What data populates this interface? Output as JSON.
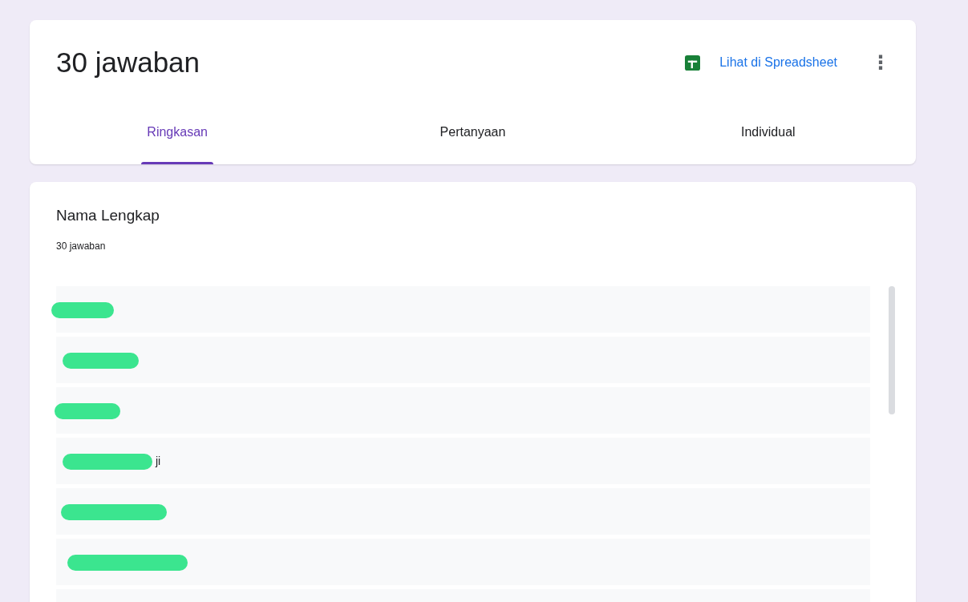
{
  "header": {
    "title": "30 jawaban",
    "sheet_link": "Lihat di Spreadsheet",
    "more_menu": "⋮"
  },
  "tabs": [
    {
      "label": "Ringkasan",
      "selected": true
    },
    {
      "label": "Pertanyaan",
      "selected": false
    },
    {
      "label": "Individual",
      "selected": false
    }
  ],
  "question": {
    "title": "Nama Lengkap",
    "count": "30 jawaban"
  },
  "responses": [
    {
      "kind": "redacted"
    },
    {
      "kind": "redacted"
    },
    {
      "kind": "redacted"
    },
    {
      "kind": "redacted",
      "visible_text": "ji"
    },
    {
      "kind": "redacted"
    },
    {
      "kind": "redacted"
    },
    {
      "kind": "cut_off"
    }
  ]
}
